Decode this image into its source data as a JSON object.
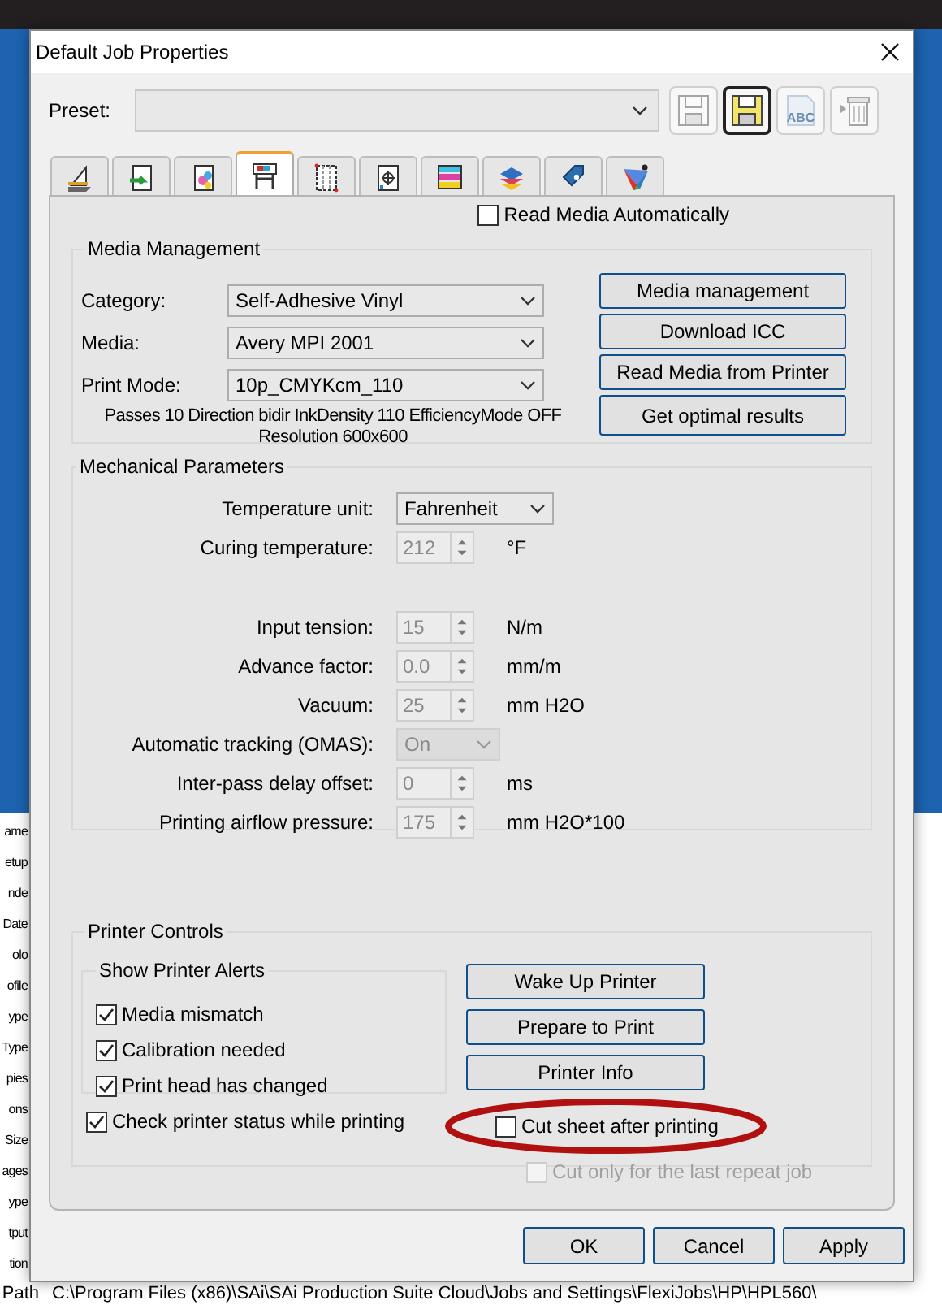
{
  "window": {
    "title": "Default Job Properties"
  },
  "preset": {
    "label": "Preset:"
  },
  "toolbar": [
    {
      "kind": "save",
      "disabled": true
    },
    {
      "kind": "save_as",
      "disabled": false
    },
    {
      "kind": "rename",
      "label": "ABC",
      "disabled": true
    },
    {
      "kind": "delete",
      "disabled": true
    }
  ],
  "tabs": [
    {
      "selected": false
    },
    {
      "selected": false
    },
    {
      "selected": false
    },
    {
      "selected": true
    },
    {
      "selected": false
    },
    {
      "selected": false
    },
    {
      "selected": false
    },
    {
      "selected": false
    },
    {
      "selected": false
    },
    {
      "selected": false
    }
  ],
  "read_media_automatically": {
    "label": "Read Media Automatically",
    "checked": false
  },
  "media_management": {
    "title": "Media Management",
    "fields": [
      {
        "label": "Category:",
        "value": "Self-Adhesive Vinyl"
      },
      {
        "label": "Media:",
        "value": "Avery MPI 2001"
      },
      {
        "label": "Print Mode:",
        "value": "10p_CMYKcm_110"
      }
    ],
    "description_lines": [
      "Passes 10 Direction bidir InkDensity 110 EfficiencyMode OFF",
      "Resolution 600x600"
    ],
    "buttons": [
      "Media management",
      "Download ICC",
      "Read Media from Printer",
      "Get optimal results"
    ]
  },
  "mechanical_parameters": {
    "title": "Mechanical Parameters",
    "groups": [
      [
        {
          "kind": "select",
          "label": "Temperature unit:",
          "value": "Fahrenheit",
          "disabled": false
        },
        {
          "kind": "spin",
          "label": "Curing temperature:",
          "value": "212",
          "unit": "°F",
          "disabled": true
        }
      ],
      [
        {
          "kind": "spin",
          "label": "Input tension:",
          "value": "15",
          "unit": "N/m",
          "disabled": true
        },
        {
          "kind": "spin",
          "label": "Advance factor:",
          "value": "0.0",
          "unit": "mm/m",
          "disabled": true
        },
        {
          "kind": "spin",
          "label": "Vacuum:",
          "value": "25",
          "unit": "mm H2O",
          "disabled": true
        },
        {
          "kind": "select",
          "label": "Automatic tracking (OMAS):",
          "value": "On",
          "disabled": true
        },
        {
          "kind": "spin",
          "label": "Inter-pass delay offset:",
          "value": "0",
          "unit": "ms",
          "disabled": true
        },
        {
          "kind": "spin",
          "label": "Printing airflow pressure:",
          "value": "175",
          "unit": "mm H2O*100",
          "disabled": true
        }
      ]
    ]
  },
  "printer_controls": {
    "title": "Printer Controls",
    "alerts": {
      "title": "Show Printer Alerts",
      "items": [
        {
          "label": "Media mismatch",
          "checked": true
        },
        {
          "label": "Calibration needed",
          "checked": true
        },
        {
          "label": "Print head has changed",
          "checked": true
        }
      ]
    },
    "check_status": {
      "label": "Check printer status while printing",
      "checked": true
    },
    "buttons": [
      "Wake Up Printer",
      "Prepare to Print",
      "Printer Info"
    ],
    "cut_sheet": {
      "label": "Cut sheet after printing",
      "checked": false,
      "disabled": false
    },
    "cut_last": {
      "label": "Cut only for the last repeat job",
      "checked": false,
      "disabled": true
    }
  },
  "footer_buttons": [
    "OK",
    "Cancel",
    "Apply"
  ],
  "background": {
    "labels": [
      "ame",
      "etup",
      "nde",
      "Date",
      "olo",
      "ofile",
      "ype",
      "Type",
      "pies",
      "ons",
      "Size",
      "ages",
      "ype",
      "tput",
      "tion"
    ],
    "path": {
      "label": "Path",
      "value": "C:\\Program Files (x86)\\SAi\\SAi Production Suite Cloud\\Jobs and Settings\\FlexiJobs\\HP\\HPL560\\"
    }
  }
}
